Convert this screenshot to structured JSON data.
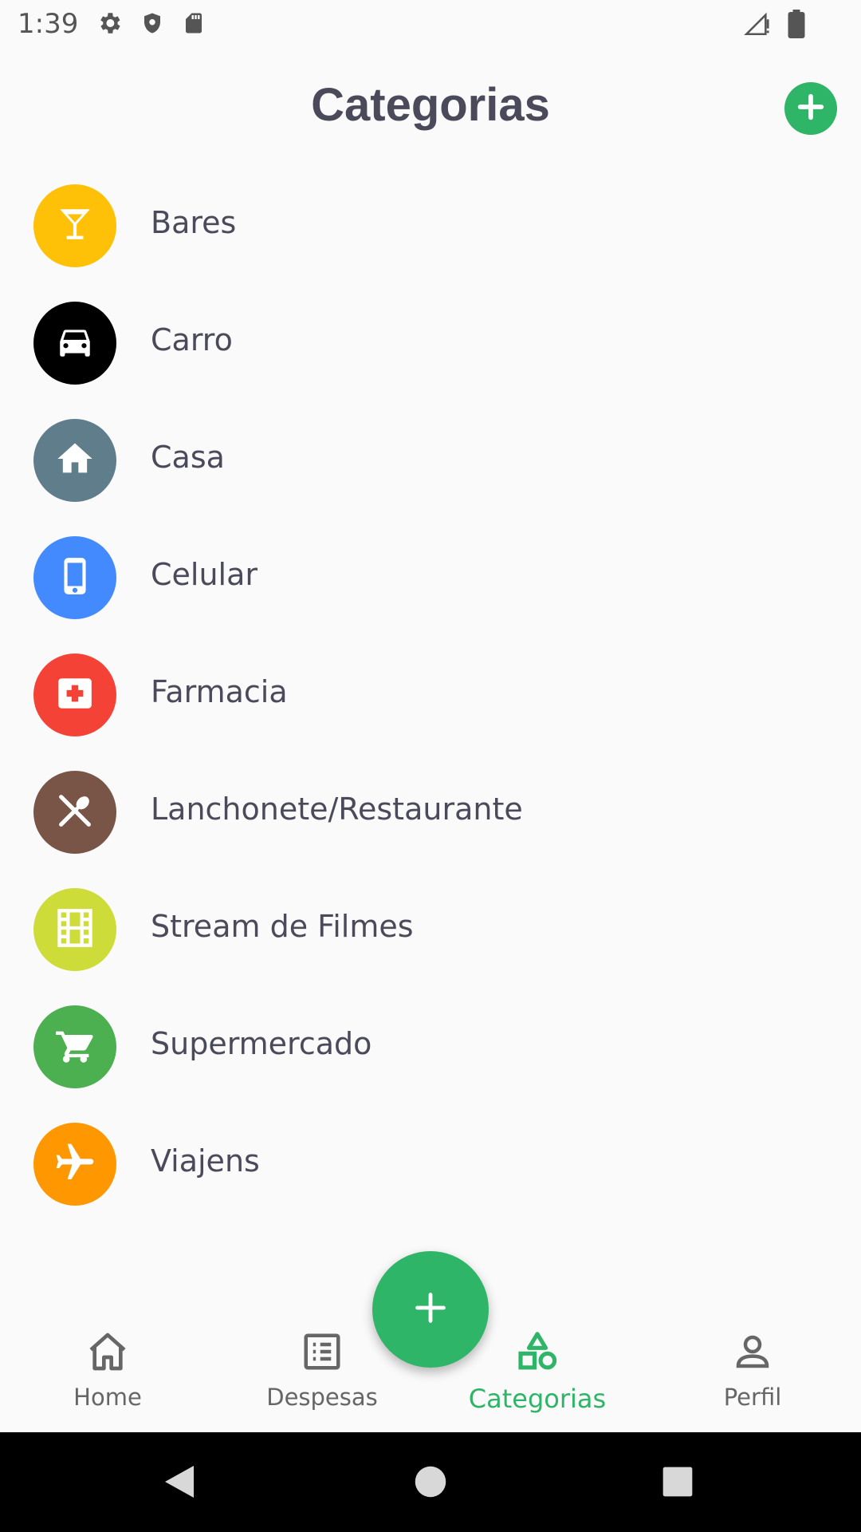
{
  "status_bar": {
    "time": "1:39",
    "icons_left": [
      "gear-icon",
      "shield-icon",
      "sd-card-icon"
    ],
    "icons_right": [
      "signal-icon",
      "battery-icon"
    ]
  },
  "header": {
    "title": "Categorias",
    "add_icon": "plus-circle-icon",
    "accent_color": "#2fb567"
  },
  "categories": [
    {
      "label": "Bares",
      "icon": "cocktail-icon",
      "color": "#ffc107"
    },
    {
      "label": "Carro",
      "icon": "car-icon",
      "color": "#000000"
    },
    {
      "label": "Casa",
      "icon": "home-icon",
      "color": "#607d8b"
    },
    {
      "label": "Celular",
      "icon": "phone-icon",
      "color": "#448aff"
    },
    {
      "label": "Farmacia",
      "icon": "medical-icon",
      "color": "#f44336"
    },
    {
      "label": "Lanchonete/Restaurante",
      "icon": "utensils-icon",
      "color": "#795548"
    },
    {
      "label": "Stream de Filmes",
      "icon": "film-icon",
      "color": "#cddc39"
    },
    {
      "label": "Supermercado",
      "icon": "cart-icon",
      "color": "#4caf50"
    },
    {
      "label": "Viajens",
      "icon": "airplane-icon",
      "color": "#ff9800"
    }
  ],
  "bottom_nav": {
    "items": [
      {
        "label": "Home",
        "icon": "home-outline-icon"
      },
      {
        "label": "Despesas",
        "icon": "list-icon"
      },
      {
        "label": "Categorias",
        "icon": "shapes-icon",
        "active": true
      },
      {
        "label": "Perfil",
        "icon": "person-icon"
      }
    ],
    "fab_icon": "plus-icon",
    "active_color": "#2fb567"
  },
  "system_nav": {
    "icons": [
      "back-icon",
      "home-circle-icon",
      "recents-icon"
    ]
  }
}
